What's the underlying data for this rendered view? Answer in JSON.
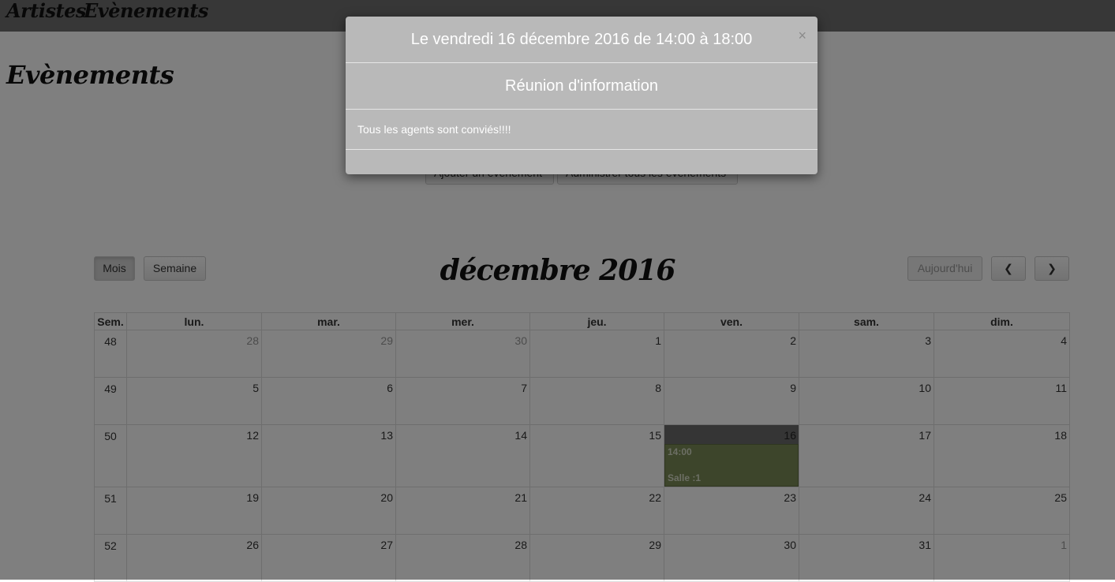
{
  "nav": {
    "artistes": "Artistes",
    "evenements": "Evènements"
  },
  "page_title": "Evènements",
  "actions": {
    "add": "Ajouter un évènement",
    "admin": "Administrer tous les évènements"
  },
  "toolbar": {
    "month": "Mois",
    "week": "Semaine",
    "today": "Aujourd'hui",
    "prev": "❮",
    "next": "❯",
    "title": "décembre 2016"
  },
  "calendar": {
    "headers": [
      "Sem.",
      "lun.",
      "mar.",
      "mer.",
      "jeu.",
      "ven.",
      "sam.",
      "dim."
    ],
    "weeks": [
      {
        "num": "48",
        "days": [
          "28",
          "29",
          "30",
          "1",
          "2",
          "3",
          "4"
        ]
      },
      {
        "num": "49",
        "days": [
          "5",
          "6",
          "7",
          "8",
          "9",
          "10",
          "11"
        ]
      },
      {
        "num": "50",
        "days": [
          "12",
          "13",
          "14",
          "15",
          "16",
          "17",
          "18"
        ]
      },
      {
        "num": "51",
        "days": [
          "19",
          "20",
          "21",
          "22",
          "23",
          "24",
          "25"
        ]
      },
      {
        "num": "52",
        "days": [
          "26",
          "27",
          "28",
          "29",
          "30",
          "31",
          "1"
        ]
      }
    ],
    "event": {
      "time": "14:00",
      "title": "Salle :1"
    }
  },
  "modal": {
    "close": "×",
    "header": "Le vendredi 16 décembre 2016 de 14:00 à 18:00",
    "subtitle": "Réunion d'information",
    "body": "Tous les agents sont conviés!!!!"
  }
}
